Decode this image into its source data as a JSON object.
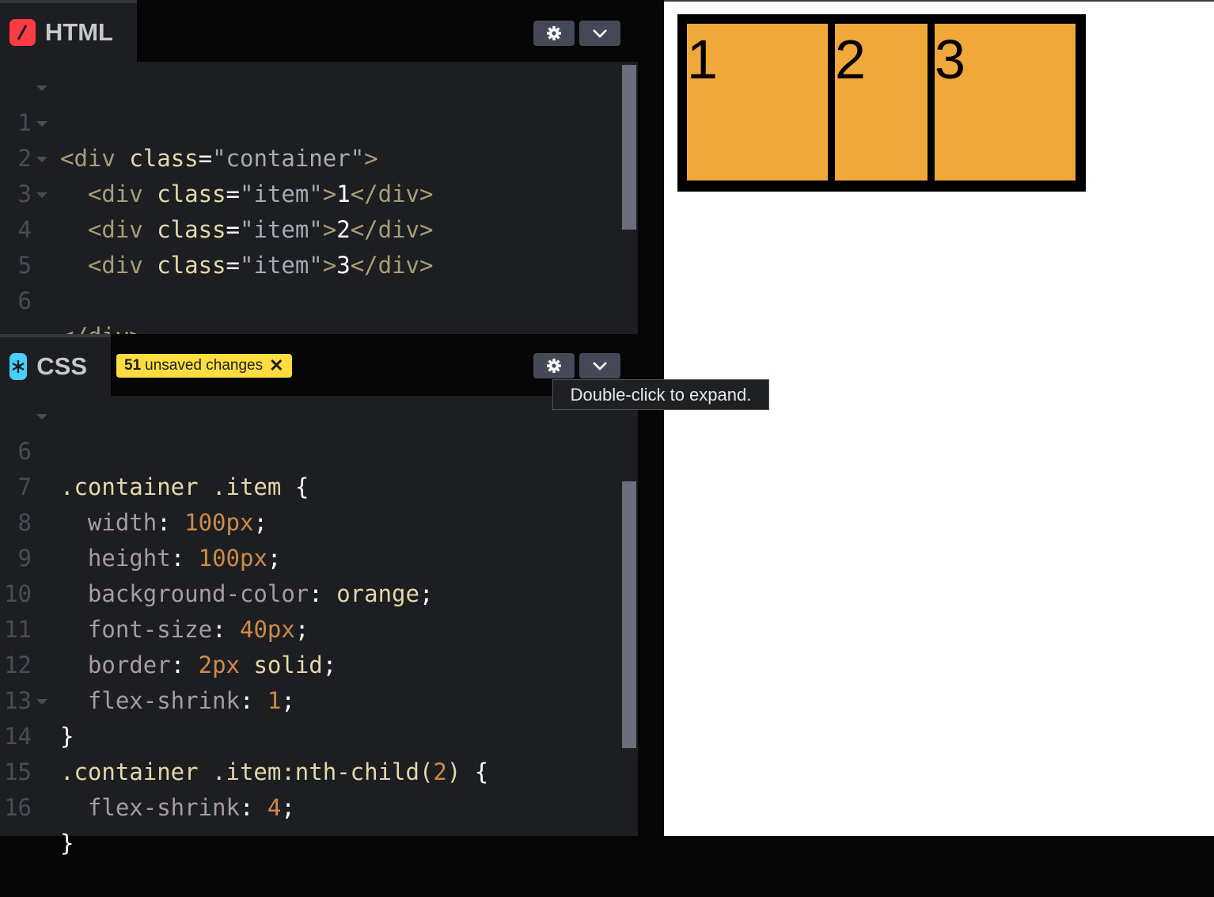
{
  "html_panel": {
    "title": "HTML",
    "icon": "slash-icon",
    "icon_color": "#ff3c41",
    "lines": [
      {
        "n": "1",
        "fold": true
      },
      {
        "n": "2",
        "fold": true
      },
      {
        "n": "3",
        "fold": true
      },
      {
        "n": "4",
        "fold": true
      },
      {
        "n": "5",
        "fold": false
      },
      {
        "n": "6",
        "fold": false
      }
    ]
  },
  "css_panel": {
    "title": "CSS",
    "icon": "asterisk-icon",
    "icon_color": "#47cfff",
    "badge_count": "51",
    "badge_label": "unsaved changes",
    "lines": [
      {
        "n": "6",
        "fold": true
      },
      {
        "n": "7",
        "fold": false
      },
      {
        "n": "8",
        "fold": false
      },
      {
        "n": "9",
        "fold": false
      },
      {
        "n": "10",
        "fold": false
      },
      {
        "n": "11",
        "fold": false
      },
      {
        "n": "12",
        "fold": false
      },
      {
        "n": "13",
        "fold": false
      },
      {
        "n": "14",
        "fold": true
      },
      {
        "n": "15",
        "fold": false
      },
      {
        "n": "16",
        "fold": false
      }
    ]
  },
  "tooltip": "Double-click to expand.",
  "preview": {
    "items": [
      "1",
      "2",
      "3"
    ],
    "item_color": "#f0a83b"
  }
}
